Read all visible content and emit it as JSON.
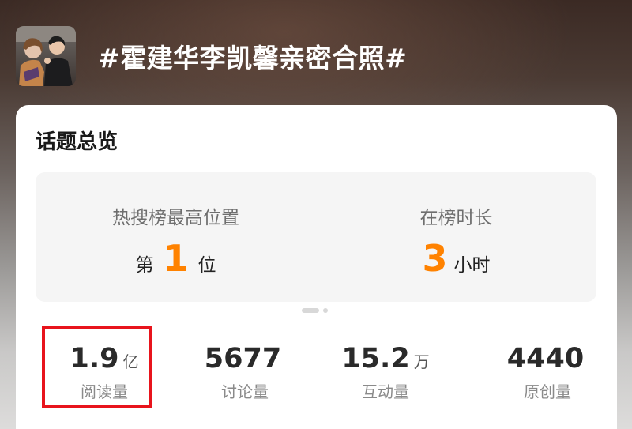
{
  "header": {
    "avatar_icon": "topic-photo-avatar",
    "topic_title": "#霍建华李凯馨亲密合照#"
  },
  "overview": {
    "title": "话题总览",
    "hot_search": {
      "label": "热搜榜最高位置",
      "prefix": "第",
      "value": "1",
      "suffix": "位"
    },
    "on_list": {
      "label": "在榜时长",
      "value": "3",
      "suffix": "小时"
    },
    "pager": {
      "pages": 2,
      "active": 1
    }
  },
  "stats": [
    {
      "value": "1.9",
      "unit": "亿",
      "label": "阅读量",
      "highlighted": true
    },
    {
      "value": "5677",
      "unit": "",
      "label": "讨论量",
      "highlighted": false
    },
    {
      "value": "15.2",
      "unit": "万",
      "label": "互动量",
      "highlighted": false
    },
    {
      "value": "4440",
      "unit": "",
      "label": "原创量",
      "highlighted": false
    }
  ],
  "colors": {
    "accent": "#ff8200",
    "highlight_border": "#e8141c",
    "card_bg": "#ffffff",
    "summary_bg": "#f5f5f5"
  }
}
